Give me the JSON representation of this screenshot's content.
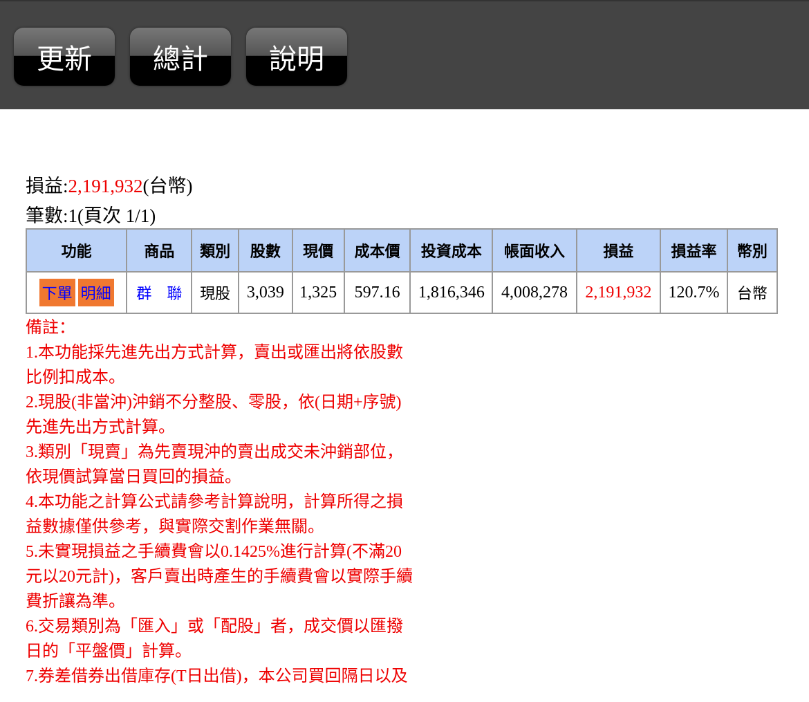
{
  "toolbar": {
    "refresh": "更新",
    "total": "總計",
    "help": "說明"
  },
  "summary": {
    "pl_label": "損益:",
    "pl_value": "2,191,932",
    "pl_currency": "(台幣)",
    "count_text": "筆數:1(頁次 1/1)"
  },
  "table": {
    "headers": [
      "功能",
      "商品",
      "類別",
      "股數",
      "現價",
      "成本價",
      "投資成本",
      "帳面收入",
      "損益",
      "損益率",
      "幣別"
    ],
    "rows": [
      {
        "order": "下單",
        "detail": "明細",
        "product": "群　聯",
        "type": "現股",
        "shares": "3,039",
        "price": "1,325",
        "cost_price": "597.16",
        "invest_cost": "1,816,346",
        "book_income": "4,008,278",
        "pl": "2,191,932",
        "pl_rate": "120.7%",
        "currency": "台幣"
      }
    ]
  },
  "notes": [
    "備註：",
    "1.本功能採先進先出方式計算，賣出或匯出將依股數",
    "比例扣成本。",
    "2.現股(非當沖)沖銷不分整股、零股，依(日期+序號)",
    "先進先出方式計算。",
    "3.類別「現賣」為先賣現沖的賣出成交未沖銷部位，",
    "依現價試算當日買回的損益。",
    "4.本功能之計算公式請參考計算說明，計算所得之損",
    "益數據僅供參考，與實際交割作業無關。",
    "5.未實現損益之手續費會以0.1425%進行計算(不滿20",
    "元以20元計)，客戶賣出時產生的手續費會以實際手續",
    "費折讓為準。",
    "6.交易類別為「匯入」或「配股」者，成交價以匯撥",
    "日的「平盤價」計算。",
    "7.券差借券出借庫存(T日出借)，本公司買回隔日以及"
  ]
}
